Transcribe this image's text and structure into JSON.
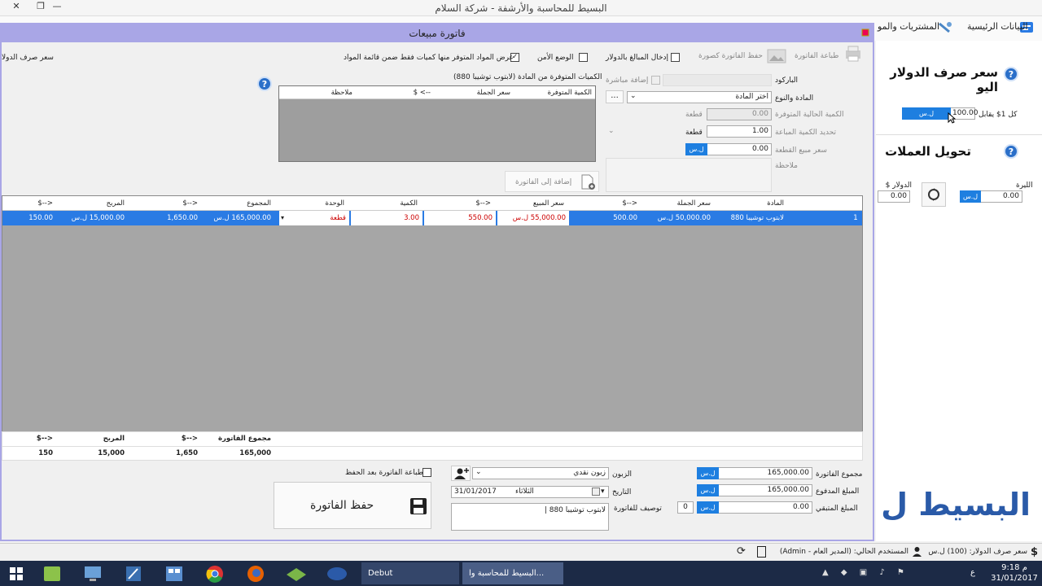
{
  "window": {
    "title": "البسيط للمحاسبة والأرشفة - شركة السلام",
    "close": "✕",
    "restore": "❐",
    "minimize": "—"
  },
  "ribbon": {
    "items": [
      {
        "label": "البيانات الرئيسية",
        "icon": "main-data-icon"
      },
      {
        "label": "المشتريات والمو",
        "icon": "purchases-icon"
      }
    ]
  },
  "right_panel": {
    "rate_title": "سعر صرف الدولار اليو",
    "rate_label": "كل 1$ يقابل",
    "rate_value": "100.00",
    "currency_tag": "ل.س",
    "convert_title": "تحويل العملات",
    "lira_label": "الليرة",
    "lira_value": "0.00",
    "dollar_label": "الدولار $",
    "dollar_value": "0.00",
    "brand": "البسيط ل",
    "help": "?"
  },
  "dialog": {
    "title": "فاتورة مبيعات",
    "toolbar": {
      "print": "طباعة الفاتورة",
      "save_image": "حفظ الفاتورة كصورة",
      "enter_dollar": "إدخال المبالغ بالدولار",
      "enter_dollar_checked": "",
      "safe_mode": "الوضع الأمن",
      "safe_mode_checked": "",
      "show_available": "عرض المواد المتوفر منها كميات فقط ضمن قائمة المواد",
      "show_available_checked": "✓",
      "rate_side": "سعر صرف الدولا"
    },
    "form": {
      "barcode_label": "الباركود",
      "direct_add": "إضافة مباشرة",
      "item_label": "المادة والنوع",
      "item_placeholder": "اختر المادة",
      "browse": "...",
      "current_qty_label": "الكمية الحالية المتوفرة",
      "current_qty_value": "0.00",
      "current_qty_unit": "قطعة",
      "sold_qty_label": "تحديد الكمية المباعة",
      "sold_qty_value": "1.00",
      "sold_qty_unit": "قطعة",
      "unit_price_label": "سعر مبيع القطعة",
      "unit_price_value": "0.00",
      "unit_price_currency": "ل.س",
      "note_label": "ملاحظة",
      "add_to_invoice": "إضافة إلى الفاتورة"
    },
    "available": {
      "title": "الكميات المتوفرة من المادة (لابتوب توشيبا 880)",
      "columns": [
        "الكمية المتوفرة",
        "سعر الجملة",
        "--> $",
        "ملاحظة"
      ]
    },
    "grid": {
      "columns": [
        "المادة",
        "سعر الجملة",
        "<--$",
        "سعر المبيع",
        "<--$",
        "الكمية",
        "الوحدة",
        "المجموع",
        "<--$",
        "المربح",
        "<--$"
      ],
      "rows": [
        {
          "index": "1",
          "item": "لابتوب توشيبا 880",
          "wholesale": "50,000.00 ل.س",
          "wholesale_usd": "500.00",
          "sale": "55,000.00 ل.س",
          "sale_usd": "550.00",
          "qty": "3.00",
          "unit": "قطعة",
          "total": "165,000.00 ل.س",
          "total_usd": "1,650.00",
          "profit": "15,000.00 ل.س",
          "profit_usd": "150.00"
        }
      ]
    },
    "totals": {
      "columns": [
        "مجموع الفاتورة",
        "<--$",
        "المربح",
        "<--$"
      ],
      "values": [
        "165,000",
        "1,650",
        "15,000",
        "150"
      ]
    },
    "footer": {
      "invoice_total_label": "مجموع الفاتورة",
      "invoice_total": "165,000.00",
      "paid_label": "المبلغ المدفوع",
      "paid": "165,000.00",
      "remaining_label": "المبلغ المتبقي",
      "remaining": "0.00",
      "currency_tag": "ل.س",
      "customer_label": "الزبون",
      "customer": "زبون نقدي",
      "date_label": "التاريخ",
      "date": "31/01/2017",
      "day": "الثلاثاء",
      "desc_label": "توصيف للفاتورة",
      "desc_count": "0",
      "desc": "لابتوب توشيبا 880 |",
      "print_after_save": "طباعة الفاتورة بعد الحفظ",
      "save_button": "حفظ الفاتورة"
    }
  },
  "status": {
    "rate": "سعر صرف الدولار: (100) ل.س",
    "user": "المستخدم الحالي: (المدير العام - Admin)"
  },
  "taskbar": {
    "task_debut": "Debut",
    "task_app": "البسيط للمحاسبة وا...",
    "time": "9:18 م",
    "date": "31/01/2017",
    "lang": "ع"
  },
  "colors": {
    "accent": "#2a7be4",
    "dialog_frame": "#a9a6e6",
    "tag_blue": "#1e7fe0"
  }
}
